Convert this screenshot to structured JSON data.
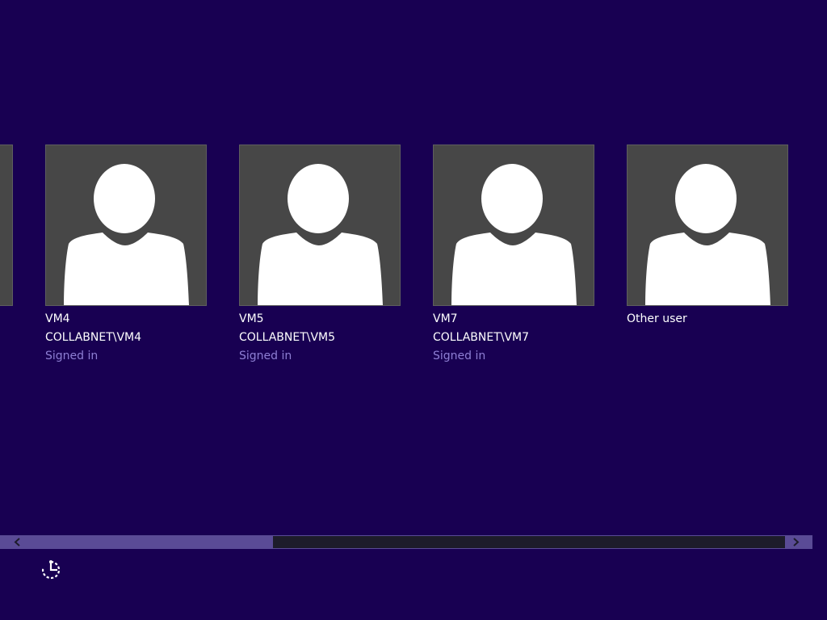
{
  "users": [
    {
      "name": "VM4",
      "account": "COLLABNET\\VM4",
      "status": "Signed in",
      "icon": "user-silhouette-icon"
    },
    {
      "name": "VM5",
      "account": "COLLABNET\\VM5",
      "status": "Signed in",
      "icon": "user-silhouette-icon"
    },
    {
      "name": "VM7",
      "account": "COLLABNET\\VM7",
      "status": "Signed in",
      "icon": "user-silhouette-icon"
    },
    {
      "name": "Other user",
      "account": "",
      "status": "",
      "icon": "user-silhouette-icon"
    }
  ],
  "scrollbar": {
    "left_icon": "chevron-left-icon",
    "right_icon": "chevron-right-icon"
  },
  "ease_of_access": {
    "icon": "ease-of-access-icon"
  },
  "colors": {
    "background": "#180052",
    "tile": "#474747",
    "status_text": "#8e7fd4",
    "scrollbar_track": "#5a4b96",
    "scrollbar_thumb": "#1d1c2b"
  }
}
